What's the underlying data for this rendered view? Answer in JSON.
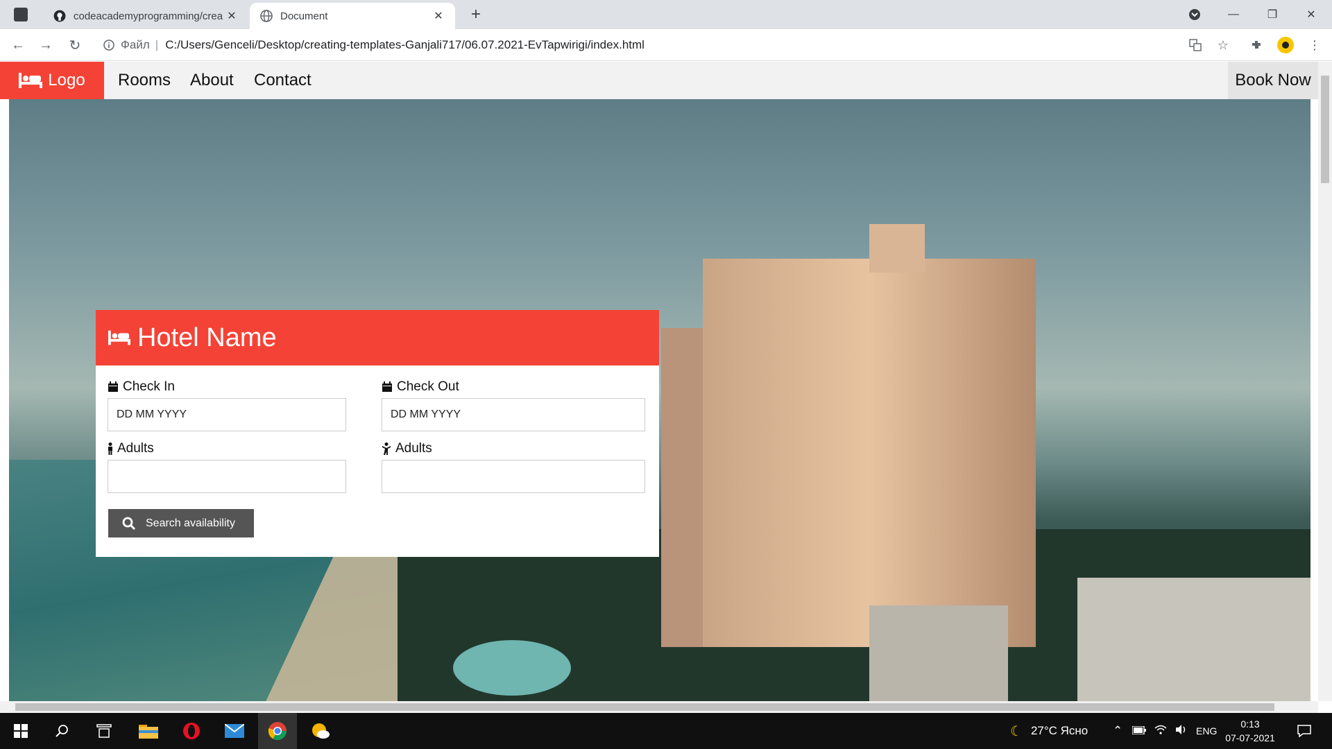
{
  "browser": {
    "tabs": [
      {
        "title": "codeacademyprogramming/crea",
        "icon": "github-icon"
      },
      {
        "title": "Document",
        "icon": "globe-icon"
      }
    ],
    "address": {
      "scheme_label": "Файл",
      "separator": "|",
      "url": "C:/Users/Genceli/Desktop/creating-templates-Ganjali717/06.07.2021-EvTapwirigi/index.html"
    }
  },
  "page": {
    "nav": {
      "logo": "Logo",
      "links": [
        "Rooms",
        "About",
        "Contact"
      ],
      "cta": "Book Now"
    },
    "card": {
      "title": "Hotel Name",
      "check_in": {
        "label": "Check In",
        "value": "DD MM YYYY"
      },
      "check_out": {
        "label": "Check Out",
        "value": "DD MM YYYY"
      },
      "adults_1": {
        "label": "Adults",
        "value": ""
      },
      "adults_2": {
        "label": "Adults",
        "value": ""
      },
      "search_button": "Search availability"
    },
    "colors": {
      "accent": "#f44336",
      "button": "#555555"
    }
  },
  "taskbar": {
    "weather": "27°C  Ясно",
    "language": "ENG",
    "time": "0:13",
    "date": "07-07-2021"
  }
}
